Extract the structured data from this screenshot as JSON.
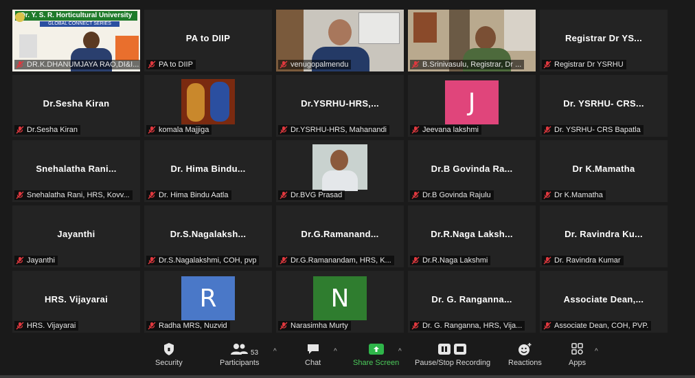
{
  "tiles": [
    {
      "label": "DR.K.DHANUMJAYA RAO,DI&I...",
      "display": "",
      "kind": "video-slide",
      "banner_title": "Dr. Y. S. R. Horticultural University",
      "banner_sub": "GLOBAL CONNECT SERIES"
    },
    {
      "label": "PA to DIIP",
      "display": "PA to DIIP",
      "kind": "name"
    },
    {
      "label": "venugopalmendu",
      "display": "",
      "kind": "video-room"
    },
    {
      "label": "B.Srinivasulu, Registrar, Dr ...",
      "display": "",
      "kind": "video-office"
    },
    {
      "label": "Registrar Dr YSRHU",
      "display": "Registrar Dr YS...",
      "kind": "name"
    },
    {
      "label": "Dr.Sesha Kiran",
      "display": "Dr.Sesha Kiran",
      "kind": "name"
    },
    {
      "label": "komala Majjiga",
      "display": "",
      "kind": "pic-deity"
    },
    {
      "label": "Dr.YSRHU-HRS, Mahanandi",
      "display": "Dr.YSRHU-HRS,...",
      "kind": "name"
    },
    {
      "label": "Jeevana lakshmi",
      "display": "",
      "kind": "letter",
      "letter": "J",
      "color": "#e0457b"
    },
    {
      "label": "Dr. YSRHU- CRS Bapatla",
      "display": "Dr. YSRHU- CRS...",
      "kind": "name"
    },
    {
      "label": "Snehalatha Rani, HRS, Kovv...",
      "display": "Snehalatha Rani...",
      "kind": "name"
    },
    {
      "label": "Dr. Hima Bindu Aatla",
      "display": "Dr. Hima Bindu...",
      "kind": "name"
    },
    {
      "label": "Dr.BVG Prasad",
      "display": "",
      "kind": "pic-person"
    },
    {
      "label": "Dr.B Govinda Rajulu",
      "display": "Dr.B Govinda Ra...",
      "kind": "name"
    },
    {
      "label": "Dr K.Mamatha",
      "display": "Dr K.Mamatha",
      "kind": "name"
    },
    {
      "label": "Jayanthi",
      "display": "Jayanthi",
      "kind": "name"
    },
    {
      "label": "Dr.S.Nagalakshmi, COH, pvp",
      "display": "Dr.S.Nagalaksh...",
      "kind": "name"
    },
    {
      "label": "Dr.G.Ramanandam, HRS, K...",
      "display": "Dr.G.Ramanand...",
      "kind": "name"
    },
    {
      "label": "Dr.R.Naga Lakshmi",
      "display": "Dr.R.Naga Laksh...",
      "kind": "name"
    },
    {
      "label": "Dr. Ravindra Kumar",
      "display": "Dr. Ravindra Ku...",
      "kind": "name"
    },
    {
      "label": "HRS. Vijayarai",
      "display": "HRS. Vijayarai",
      "kind": "name"
    },
    {
      "label": "Radha MRS, Nuzvid",
      "display": "",
      "kind": "letter",
      "letter": "R",
      "color": "#4a78c8"
    },
    {
      "label": "Narasimha Murty",
      "display": "",
      "kind": "letter",
      "letter": "N",
      "color": "#2f7d2f"
    },
    {
      "label": "Dr. G. Ranganna, HRS, Vija...",
      "display": "Dr. G. Ranganna...",
      "kind": "name"
    },
    {
      "label": "Associate Dean, COH, PVP.",
      "display": "Associate Dean,...",
      "kind": "name"
    }
  ],
  "toolbar": {
    "security": "Security",
    "participants": "Participants",
    "participants_count": "53",
    "chat": "Chat",
    "share": "Share Screen",
    "record": "Pause/Stop Recording",
    "reactions": "Reactions",
    "apps": "Apps"
  },
  "colors": {
    "muted": "#e0383e",
    "share": "#2fb54a",
    "active_border": "#e4e400"
  }
}
